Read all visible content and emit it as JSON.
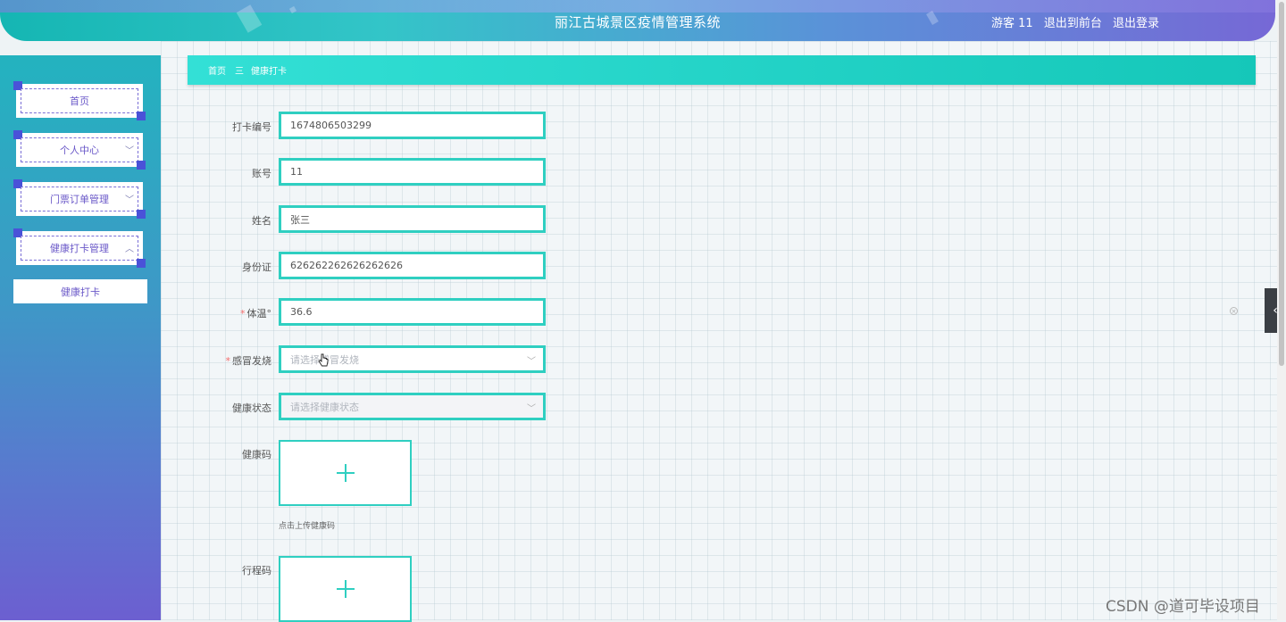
{
  "header": {
    "title": "丽江古城景区疫情管理系统",
    "user": "游客 11",
    "back_front": "退出到前台",
    "logout": "退出登录"
  },
  "sidebar": {
    "items": [
      {
        "label": "首页",
        "expandable": false
      },
      {
        "label": "个人中心",
        "expandable": true,
        "chevron": "chevron-down-icon"
      },
      {
        "label": "门票订单管理",
        "expandable": true,
        "chevron": "chevron-down-icon"
      },
      {
        "label": "健康打卡管理",
        "expandable": true,
        "chevron": "chevron-up-icon"
      }
    ],
    "sub_items": [
      {
        "label": "健康打卡"
      }
    ]
  },
  "breadcrumb": {
    "home": "首页",
    "separator": "三",
    "current": "健康打卡"
  },
  "form": {
    "fields": [
      {
        "label": "打卡编号",
        "value": "1674806503299",
        "required": false
      },
      {
        "label": "账号",
        "value": "11",
        "required": false
      },
      {
        "label": "姓名",
        "value": "张三",
        "required": false
      },
      {
        "label": "身份证",
        "value": "626262262626262626",
        "required": false
      },
      {
        "label": "体温",
        "value": "36.6",
        "required": true,
        "suffix": "°"
      },
      {
        "label": "感冒发烧",
        "placeholder": "请选择感冒发烧",
        "required": true
      },
      {
        "label": "健康状态",
        "placeholder": "请选择健康状态",
        "required": false
      }
    ],
    "uploads": [
      {
        "label": "健康码",
        "tip": "点击上传健康码"
      },
      {
        "label": "行程码"
      }
    ]
  },
  "watermark": "CSDN @道可毕设项目",
  "colors": {
    "accent": "#2fcfc1",
    "header_start": "#15b6b3",
    "header_end": "#7668d6",
    "menu_text": "#6a58c8"
  }
}
